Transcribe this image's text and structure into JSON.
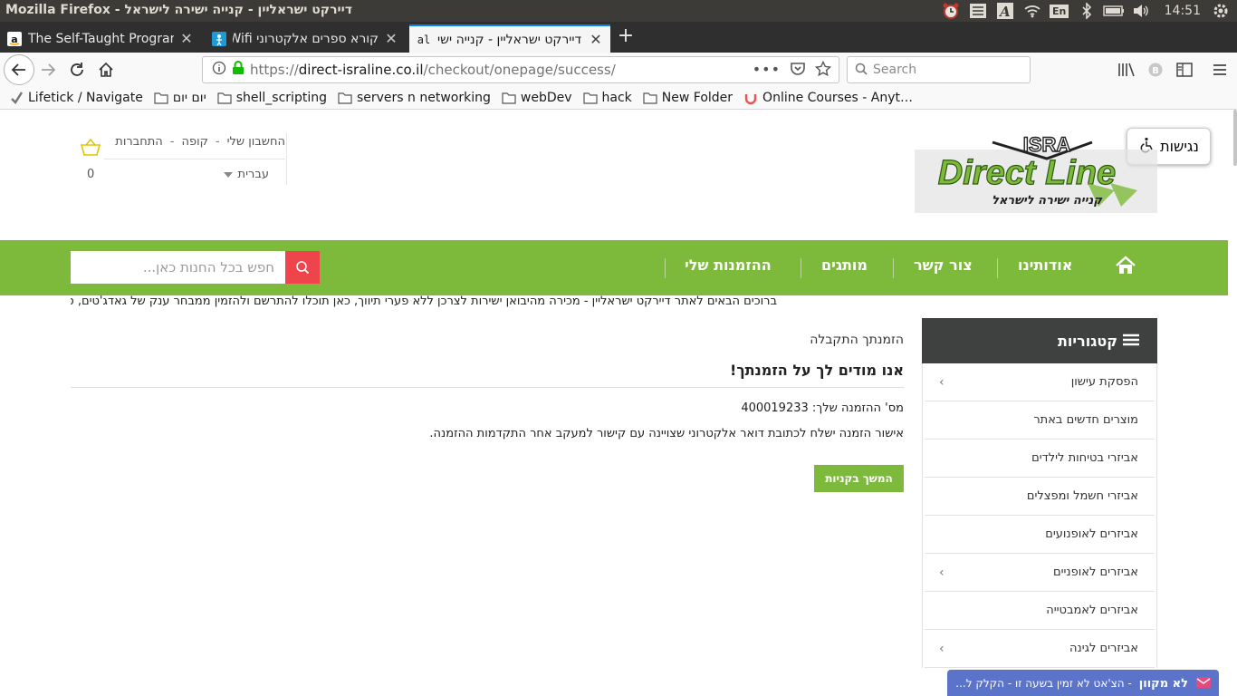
{
  "os": {
    "window_title": "Mozilla Firefox - דיירקט ישראליין - קנייה ישירה לישראל",
    "lang_indicator": "En",
    "time": "14:51"
  },
  "browser": {
    "tabs": [
      {
        "label": "The Self-Taught Program",
        "favicon": "amazon-icon",
        "active": false
      },
      {
        "label": "קורא ספרים אלקטרוני Wifi",
        "favicon": "ereader-icon",
        "active": false
      },
      {
        "label": "דיירקט ישראליין - קנייה ישי",
        "favicon": "al-icon",
        "favicon_text": "al",
        "active": true
      }
    ],
    "url_scheme": "https://",
    "url_host": "direct-israline.co.il",
    "url_path": "/checkout/onepage/success/",
    "search_placeholder": "Search",
    "bookmarks": [
      {
        "label": "Lifetick / Navigate",
        "icon": "lifetick-icon"
      },
      {
        "label": "יום יום",
        "icon": "folder-icon"
      },
      {
        "label": "shell_scripting",
        "icon": "folder-icon"
      },
      {
        "label": "servers n networking",
        "icon": "folder-icon"
      },
      {
        "label": "webDev",
        "icon": "folder-icon"
      },
      {
        "label": "hack",
        "icon": "folder-icon"
      },
      {
        "label": "New Folder",
        "icon": "folder-icon"
      },
      {
        "label": "Online Courses - Anyt…",
        "icon": "udemy-icon"
      }
    ]
  },
  "site": {
    "accessibility_label": "נגישות",
    "logo": {
      "top": "ISRA",
      "main": "Direct Line",
      "tagline": "קנייה ישירה לישראל"
    },
    "toplinks": {
      "account": "החשבון שלי",
      "checkout": "קופה",
      "login": "התחברות",
      "separator": "-"
    },
    "language": "עברית",
    "cart_count": "0",
    "nav": {
      "home": "home",
      "about": "אודותינו",
      "contact": "צור קשר",
      "brands": "מותגים",
      "orders": "ההזמנות שלי"
    },
    "search_placeholder": "חפש בכל החנות כאן...",
    "welcome": "ברוכים הבאים לאתר דיירקט ישראליין - מכירה מהיבואן ישירות לצרכן ללא פערי תיווך, כאן תוכלו להתרשם ולהזמין ממבחר ענק של גאדג'טים, סינו",
    "sidebar": {
      "title": "קטגוריות",
      "items": [
        {
          "label": "הפסקת עישון",
          "has_sub": true
        },
        {
          "label": "מוצרים חדשים באתר",
          "has_sub": false
        },
        {
          "label": "אביזרי בטיחות לילדים",
          "has_sub": false
        },
        {
          "label": "אביזרי חשמל ומפצלים",
          "has_sub": false
        },
        {
          "label": "אביזרים לאופנועים",
          "has_sub": false
        },
        {
          "label": "אביזרים לאופניים",
          "has_sub": true
        },
        {
          "label": "אביזרים לאמבטייה",
          "has_sub": false
        },
        {
          "label": "אביזרים לגינה",
          "has_sub": true
        }
      ]
    },
    "main": {
      "breadcrumb": "הזמנתך התקבלה",
      "thank_you": "אנו מודים לך על הזמנתך!",
      "order_number": "מס' ההזמנה שלך: 400019233",
      "confirmation": "אישור הזמנה ישלח לכתובת דואר אלקטרוני שצויינה עם קישור למעקב אחר התקדמות ההזמנה.",
      "continue_label": "המשך בקניות"
    },
    "chat": {
      "status": "לא מקוון",
      "message": "- הצ'אט לא זמין בשעה זו - הקלק ל..."
    }
  },
  "colors": {
    "green": "#7dba3b",
    "red": "#f0444c",
    "sidebar_head": "#3f4141",
    "chat": "#5b74c9"
  }
}
